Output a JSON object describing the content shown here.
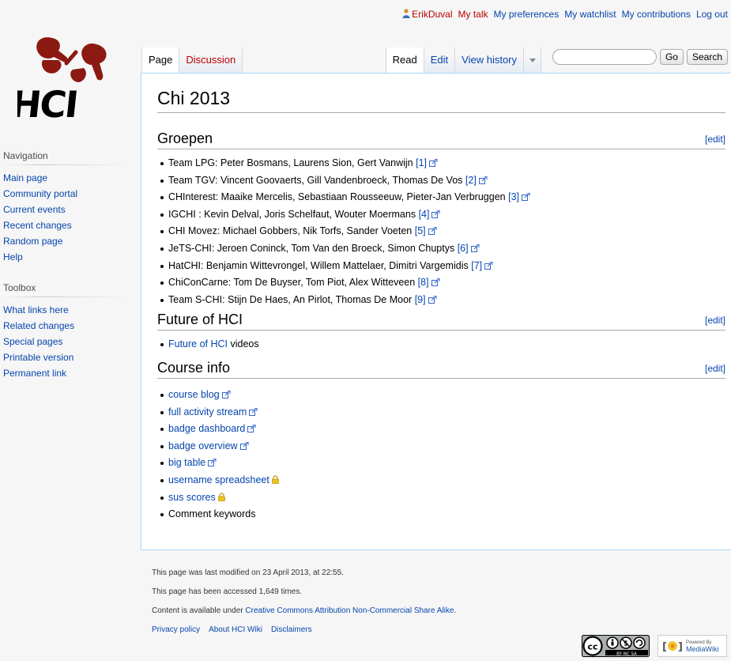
{
  "personal": {
    "username": "ErikDuval",
    "talk": "My talk",
    "preferences": "My preferences",
    "watchlist": "My watchlist",
    "contributions": "My contributions",
    "logout": "Log out"
  },
  "logo_text": "HCI",
  "sidebar": {
    "navigation": {
      "heading": "Navigation",
      "items": [
        "Main page",
        "Community portal",
        "Current events",
        "Recent changes",
        "Random page",
        "Help"
      ]
    },
    "toolbox": {
      "heading": "Toolbox",
      "items": [
        "What links here",
        "Related changes",
        "Special pages",
        "Printable version",
        "Permanent link"
      ]
    }
  },
  "tabs": {
    "page": "Page",
    "discussion": "Discussion",
    "read": "Read",
    "edit": "Edit",
    "history": "View history"
  },
  "search": {
    "value": "",
    "go": "Go",
    "search": "Search"
  },
  "title": "Chi 2013",
  "edit_label": "[edit]",
  "groepen": {
    "heading": "Groepen",
    "items": [
      {
        "text": "Team LPG: Peter Bosmans, Laurens Sion, Gert Vanwijn",
        "ref": "[1]"
      },
      {
        "text": "Team TGV: Vincent Goovaerts, Gill Vandenbroeck, Thomas De Vos",
        "ref": "[2]"
      },
      {
        "text": "CHInterest: Maaike Mercelis, Sebastiaan Rousseeuw, Pieter-Jan Verbruggen",
        "ref": "[3]"
      },
      {
        "text": "IGCHI : Kevin Delval, Joris Schelfaut, Wouter Moermans",
        "ref": "[4]"
      },
      {
        "text": "CHI Movez: Michael Gobbers, Nik Torfs, Sander Voeten",
        "ref": "[5]"
      },
      {
        "text": "JeTS-CHI: Jeroen Coninck, Tom Van den Broeck, Simon Chuptys",
        "ref": "[6]"
      },
      {
        "text": "HatCHI: Benjamin Wittevrongel, Willem Mattelaer, Dimitri Vargemidis",
        "ref": "[7]"
      },
      {
        "text": "ChiConCarne: Tom De Buyser, Tom Piot, Alex Witteveen",
        "ref": "[8]"
      },
      {
        "text": "Team S-CHI: Stijn De Haes, An Pirlot, Thomas De Moor",
        "ref": "[9]"
      }
    ]
  },
  "future": {
    "heading": "Future of HCI",
    "link": "Future of HCI",
    "suffix": " videos"
  },
  "course": {
    "heading": "Course info",
    "items": [
      {
        "text": "course blog",
        "icon": "external-link-icon"
      },
      {
        "text": "full activity stream",
        "icon": "external-link-icon"
      },
      {
        "text": "badge dashboard",
        "icon": "external-link-icon"
      },
      {
        "text": "badge overview",
        "icon": "external-link-icon"
      },
      {
        "text": "big table",
        "icon": "external-link-icon"
      },
      {
        "text": "username spreadsheet",
        "icon": "lock-icon"
      },
      {
        "text": "sus scores",
        "icon": "lock-icon"
      },
      {
        "text": "Comment keywords",
        "icon": ""
      }
    ]
  },
  "footer": {
    "modified": "This page was last modified on 23 April 2013, at 22:55.",
    "accessed": "This page has been accessed 1,649 times.",
    "license_prefix": "Content is available under ",
    "license_link": "Creative Commons Attribution Non-Commercial Share Alike",
    "license_suffix": ".",
    "privacy": "Privacy policy",
    "about": "About HCI Wiki",
    "disclaimers": "Disclaimers",
    "cc_badge_caption": "BY NC SA",
    "mw_powered": "Powered By",
    "mw_name": "MediaWiki"
  },
  "colors": {
    "link": "#0645ad",
    "redlink": "#ba0000",
    "content_border": "#a7d7f9",
    "logo_red": "#8b1a12"
  }
}
